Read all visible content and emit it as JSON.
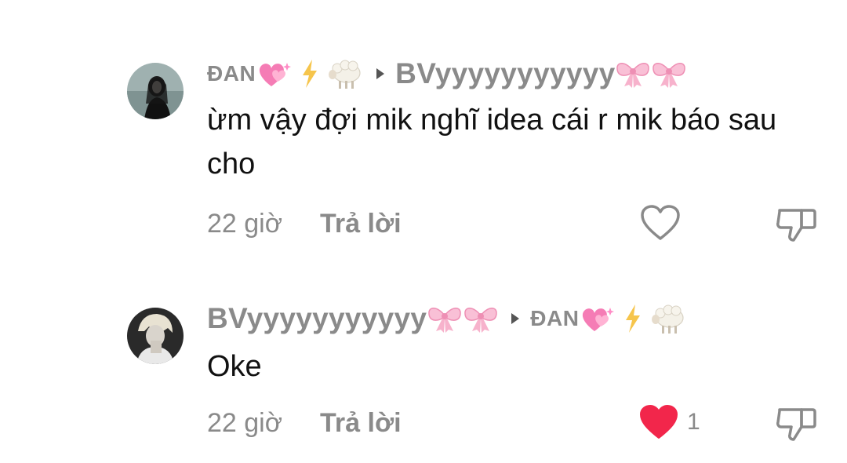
{
  "comments": [
    {
      "author": "ĐAN",
      "reply_to": "BVyyyyyyyyyyy",
      "text": "ừm vậy đợi mik nghĩ idea cái r mik báo sau cho",
      "time": "22 giờ",
      "reply_label": "Trả lời",
      "liked": false,
      "like_count": ""
    },
    {
      "author": "BVyyyyyyyyyyy",
      "reply_to": "ĐAN",
      "text": "Oke",
      "time": "22 giờ",
      "reply_label": "Trả lời",
      "liked": true,
      "like_count": "1"
    }
  ],
  "colors": {
    "muted": "#8a8a8a",
    "text": "#111111",
    "like_active": "#f2264b",
    "icon_outline": "#8a8a8a"
  },
  "icons": {
    "like": "heart-icon",
    "dislike": "thumbs-down-icon",
    "reply_arrow": "caret-right-icon"
  }
}
